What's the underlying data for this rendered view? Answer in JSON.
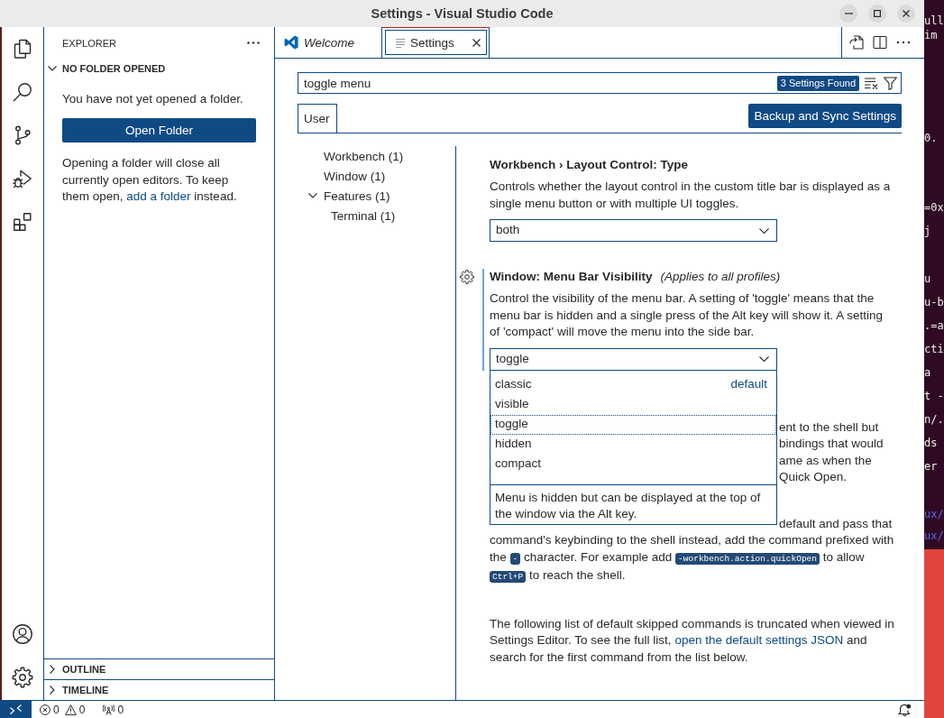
{
  "window": {
    "title": "Settings - Visual Studio Code",
    "controls": [
      {
        "kind": "minimize"
      },
      {
        "kind": "maximize"
      },
      {
        "kind": "close"
      }
    ]
  },
  "activity_bar": {
    "top": [
      {
        "kind": "explorer"
      },
      {
        "kind": "search"
      },
      {
        "kind": "source_control"
      },
      {
        "kind": "run_debug"
      },
      {
        "kind": "extensions"
      }
    ],
    "bottom": [
      {
        "kind": "accounts"
      },
      {
        "kind": "manage"
      }
    ]
  },
  "sidebar": {
    "title": "EXPLORER",
    "sections": [
      {
        "title": "NO FOLDER OPENED",
        "expanded": true,
        "message": "You have not yet opened a folder.",
        "button": "Open Folder",
        "hint": {
          "before": "Opening a folder will close all currently open editors. To keep them open, ",
          "link": "add a folder",
          "after": " instead."
        }
      },
      {
        "title": "OUTLINE",
        "expanded": false
      },
      {
        "title": "TIMELINE",
        "expanded": false
      }
    ]
  },
  "editor": {
    "tabs": [
      {
        "label": "Welcome",
        "kind": "welcome",
        "preview": true,
        "selected": false
      },
      {
        "label": "Settings",
        "kind": "settings",
        "preview": false,
        "selected": true
      }
    ],
    "actions": [
      {
        "kind": "open_json"
      },
      {
        "kind": "split"
      },
      {
        "kind": "more"
      }
    ]
  },
  "settings": {
    "search": {
      "value": "toggle menu",
      "badge": "3 Settings Found"
    },
    "scopes": [
      {
        "label": "User",
        "selected": true
      }
    ],
    "sync_button": "Backup and Sync Settings",
    "toc": [
      {
        "label": "Workbench (1)"
      },
      {
        "label": "Window (1)"
      },
      {
        "label": "Features (1)",
        "expanded": true,
        "children": [
          {
            "label": "Terminal (1)"
          }
        ]
      }
    ],
    "items": [
      {
        "kind": "enum",
        "focused": false,
        "title": "Workbench › Layout Control: Type",
        "description": "Controls whether the layout control in the custom title bar is displayed as a single menu button or with multiple UI toggles.",
        "value": "both"
      },
      {
        "kind": "enum",
        "focused": true,
        "title": "Window: Menu Bar Visibility",
        "scope_note": "(Applies to all profiles)",
        "description": "Control the visibility of the menu bar. A setting of 'toggle' means that the menu bar is hidden and a single press of the Alt key will show it. A setting of 'compact' will move the menu into the side bar.",
        "value": "toggle",
        "options": [
          {
            "label": "classic",
            "tag": "default",
            "selected": false
          },
          {
            "label": "visible",
            "selected": false
          },
          {
            "label": "toggle",
            "selected": true
          },
          {
            "label": "hidden",
            "selected": false
          },
          {
            "label": "compact",
            "selected": false
          }
        ],
        "option_description": "Menu is hidden but can be displayed at the top of the window via the Alt key."
      },
      {
        "kind": "array",
        "focused": false,
        "visible_line_ends": [
          "ent to the shell but",
          "bindings that would",
          "ame as when the",
          "Quick Open."
        ],
        "paragraphs": [
          {
            "lead": "default and pass that",
            "parts": [
              {
                "text": "command's keybinding to the shell instead, add the command prefixed with the "
              },
              {
                "code": "-"
              },
              {
                "text": " character. For example add "
              },
              {
                "code": "-workbench.action.quickOpen"
              },
              {
                "text": " to allow "
              },
              {
                "code": "Ctrl+P"
              },
              {
                "text": " to reach the shell."
              }
            ]
          },
          {
            "parts": [
              {
                "text": "The following list of default skipped commands is truncated when viewed in Settings Editor. To see the full list, "
              },
              {
                "link": "open the default settings JSON"
              },
              {
                "text": " and search for the first command from the list below."
              }
            ]
          }
        ]
      }
    ]
  },
  "status_bar": {
    "problems": {
      "errors": "0",
      "warnings": "0"
    },
    "ports": {
      "count": "0"
    },
    "notifications": {
      "unread": true
    }
  },
  "background": {
    "terminal_blocks": [
      {
        "lines": [
          {
            "text": "ull",
            "kind": "plain"
          },
          {
            "text": "im",
            "kind": "plain"
          }
        ]
      },
      {
        "lines": [
          {
            "text": "0.",
            "kind": "plain"
          }
        ]
      },
      {
        "lines": [
          {
            "text": "=0x",
            "kind": "plain"
          },
          {
            "text": "j",
            "kind": "plain"
          }
        ]
      },
      {
        "lines": [
          {
            "text": "u",
            "kind": "plain"
          },
          {
            "text": "u-b",
            "kind": "plain"
          },
          {
            "text": ".=a",
            "kind": "plain"
          },
          {
            "text": "cti",
            "kind": "plain"
          },
          {
            "text": "a",
            "kind": "plain"
          },
          {
            "text": "t -",
            "kind": "plain"
          },
          {
            "text": "n/.",
            "kind": "plain"
          },
          {
            "text": "ds",
            "kind": "plain"
          },
          {
            "text": "er",
            "kind": "plain"
          }
        ]
      },
      {
        "lines": [
          {
            "text": "ux/",
            "kind": "path"
          },
          {
            "text": "ux/",
            "kind": "path"
          }
        ]
      }
    ]
  }
}
